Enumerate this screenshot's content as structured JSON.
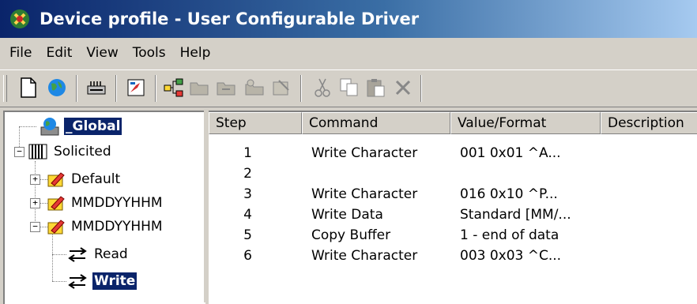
{
  "window": {
    "title": "Device profile - User Configurable Driver"
  },
  "menu": [
    "File",
    "Edit",
    "View",
    "Tools",
    "Help"
  ],
  "toolbar": {
    "buttons": [
      "new-icon",
      "globe-icon",
      "device-icon",
      "edit-icon",
      "hierarchy-icon",
      "folder-icon",
      "folder2-icon",
      "folder3-icon",
      "properties-icon",
      "cut-icon",
      "copy-icon",
      "paste-icon",
      "delete-icon"
    ]
  },
  "tree": {
    "global": "_Global",
    "solicited": "Solicited",
    "default": "Default",
    "mmdd1": "MMDDYYHHM",
    "mmdd2": "MMDDYYHHM",
    "read": "Read",
    "write": "Write"
  },
  "list": {
    "columns": [
      "Step",
      "Command",
      "Value/Format",
      "Description"
    ],
    "rows": [
      {
        "step": "1",
        "command": "Write Character",
        "value": "001  0x01  ^A..."
      },
      {
        "step": "2",
        "command": "",
        "value": ""
      },
      {
        "step": "3",
        "command": "Write Character",
        "value": "016  0x10  ^P..."
      },
      {
        "step": "4",
        "command": "Write Data",
        "value": "Standard [MM/..."
      },
      {
        "step": "5",
        "command": "Copy Buffer",
        "value": "1 - end of data"
      },
      {
        "step": "6",
        "command": "Write Character",
        "value": "003  0x03  ^C..."
      }
    ]
  }
}
